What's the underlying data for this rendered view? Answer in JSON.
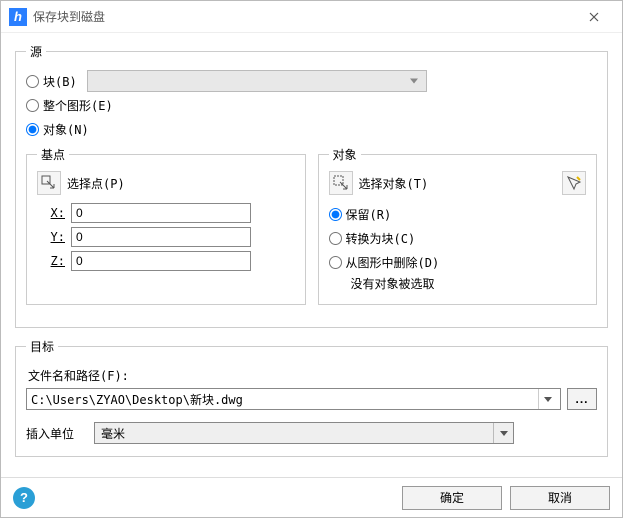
{
  "title": "保存块到磁盘",
  "source": {
    "legend": "源",
    "block": {
      "label": "块(B)"
    },
    "whole": {
      "label": "整个图形(E)"
    },
    "objects": {
      "label": "对象(N)"
    }
  },
  "basepoint": {
    "legend": "基点",
    "pick_label": "选择点(P)",
    "x_label": "X:",
    "y_label": "Y:",
    "z_label": "Z:",
    "x": "0",
    "y": "0",
    "z": "0"
  },
  "objects_panel": {
    "legend": "对象",
    "select_label": "选择对象(T)",
    "retain": "保留(R)",
    "convert": "转换为块(C)",
    "delete": "从图形中删除(D)",
    "status": "没有对象被选取"
  },
  "target": {
    "legend": "目标",
    "path_label": "文件名和路径(F):",
    "path_value": "C:\\Users\\ZYAO\\Desktop\\新块.dwg",
    "browse": "...",
    "unit_label": "插入单位",
    "unit_value": "毫米"
  },
  "buttons": {
    "ok": "确定",
    "cancel": "取消"
  }
}
